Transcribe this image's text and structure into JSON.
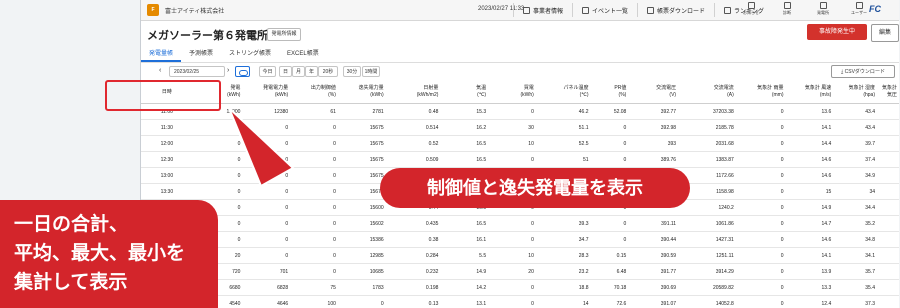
{
  "company": "富士アイティ株式会社",
  "datetime": "2023/02/27 11:33",
  "topnav": [
    {
      "label": "事業者情報",
      "icon": "building-icon"
    },
    {
      "label": "イベント一覧",
      "icon": "list-icon"
    },
    {
      "label": "帳票ダウンロード",
      "icon": "download-icon"
    },
    {
      "label": "ランキング",
      "icon": "chart-icon"
    }
  ],
  "right_icons": [
    {
      "label": "お知らせ",
      "icon": "mail-icon"
    },
    {
      "label": "診断",
      "icon": "bell-icon"
    },
    {
      "label": "発電所",
      "icon": "plant-icon"
    },
    {
      "label": "ユーザー",
      "icon": "user-icon"
    }
  ],
  "brand_logo": "FC",
  "page_title": "メガソーラー第６発電所",
  "info_button": "発電所情報",
  "alert_button": "事故障発生中",
  "edit_button": "編集",
  "tabs": [
    "発電量帳",
    "予測帳票",
    "ストリング帳票",
    "EXCEL帳票"
  ],
  "toolbar": {
    "date": "2023/02/25",
    "today": "今日",
    "day": "日",
    "month": "月",
    "year": "年",
    "interval_20": "20秒",
    "interval_30": "30分",
    "interval_1h": "1時間",
    "csv": "CSVダウンロード"
  },
  "columns": [
    [
      "日時",
      ""
    ],
    [
      "発電",
      "(kWh)"
    ],
    [
      "発電電力量",
      "(kWh)"
    ],
    [
      "出力制御値",
      "(%)"
    ],
    [
      "逸失電力量",
      "(kWh)"
    ],
    [
      "日射量",
      "(kWh/m2)"
    ],
    [
      "気温",
      "(℃)"
    ],
    [
      "買電",
      "(kWh)"
    ],
    [
      "パネル温度",
      "(℃)"
    ],
    [
      "PR値",
      "(%)"
    ],
    [
      "交流電圧",
      "(V)"
    ],
    [
      "交流電流",
      "(A)"
    ],
    [
      "気象計 雨量",
      "(mm)"
    ],
    [
      "気象計 風速",
      "(m/s)"
    ],
    [
      "気象計 湿度",
      "(hpa)"
    ],
    [
      "気象計 気圧",
      ""
    ]
  ],
  "rows": [
    [
      "11:00",
      "12000",
      "12380",
      "61",
      "2781",
      "0.48",
      "15.3",
      "0",
      "46.2",
      "52.08",
      "392.77",
      "37203.38",
      "0",
      "13.6",
      "43.4"
    ],
    [
      "11:30",
      "0",
      "0",
      "0",
      "15675",
      "0.514",
      "16.2",
      "30",
      "51.1",
      "0",
      "392.98",
      "2185.78",
      "0",
      "14.1",
      "43.4"
    ],
    [
      "12:00",
      "0",
      "0",
      "0",
      "15675",
      "0.52",
      "16.5",
      "10",
      "52.5",
      "0",
      "393",
      "2031.68",
      "0",
      "14.4",
      "39.7"
    ],
    [
      "12:30",
      "0",
      "0",
      "0",
      "15675",
      "0.509",
      "16.5",
      "0",
      "51",
      "0",
      "389.76",
      "1383.87",
      "0",
      "14.6",
      "37.4"
    ],
    [
      "13:00",
      "0",
      "0",
      "0",
      "15675",
      "0.486",
      "16.5",
      "0",
      "",
      "0",
      "",
      "1172.66",
      "0",
      "14.6",
      "34.9"
    ],
    [
      "13:30",
      "0",
      "0",
      "0",
      "15675",
      "0.46",
      "16.5",
      "0",
      "",
      "0",
      "",
      "1158.98",
      "0",
      "15",
      "34"
    ],
    [
      "14:00",
      "0",
      "0",
      "0",
      "15600",
      "0.44",
      "16.5",
      "0",
      "",
      "0",
      "",
      "1240.2",
      "0",
      "14.9",
      "34.4"
    ],
    [
      "14:30",
      "0",
      "0",
      "0",
      "15602",
      "0.435",
      "16.5",
      "0",
      "39.3",
      "0",
      "391.11",
      "1061.86",
      "0",
      "14.7",
      "35.2"
    ],
    [
      "15:00",
      "0",
      "0",
      "0",
      "15386",
      "0.38",
      "16.1",
      "0",
      "34.7",
      "0",
      "390.44",
      "1427.31",
      "0",
      "14.6",
      "34.8"
    ],
    [
      "",
      "20",
      "0",
      "0",
      "12985",
      "0.284",
      "5.5",
      "10",
      "28.3",
      "0.15",
      "390.59",
      "1251.11",
      "0",
      "14.1",
      "34.1"
    ],
    [
      "",
      "720",
      "701",
      "0",
      "10685",
      "0.232",
      "14.9",
      "20",
      "23.2",
      "6.48",
      "391.77",
      "3914.29",
      "0",
      "13.9",
      "35.7"
    ],
    [
      "",
      "6680",
      "6828",
      "75",
      "1783",
      "0.198",
      "14.2",
      "0",
      "18.8",
      "70.18",
      "390.69",
      "20589.82",
      "0",
      "13.3",
      "35.4"
    ],
    [
      "",
      "4540",
      "4646",
      "100",
      "0",
      "0.13",
      "13.1",
      "0",
      "14",
      "72.6",
      "391.07",
      "14052.8",
      "0",
      "12.4",
      "37.3"
    ]
  ],
  "callout_text": "制御値と逸失発電量を表示",
  "left_note": [
    "一日の合計、",
    "平均、最大、最小を",
    "集計して表示"
  ],
  "colors": {
    "accent": "#1e6fd9",
    "alert": "#d3252b",
    "highlight_border": "#e0282f"
  }
}
